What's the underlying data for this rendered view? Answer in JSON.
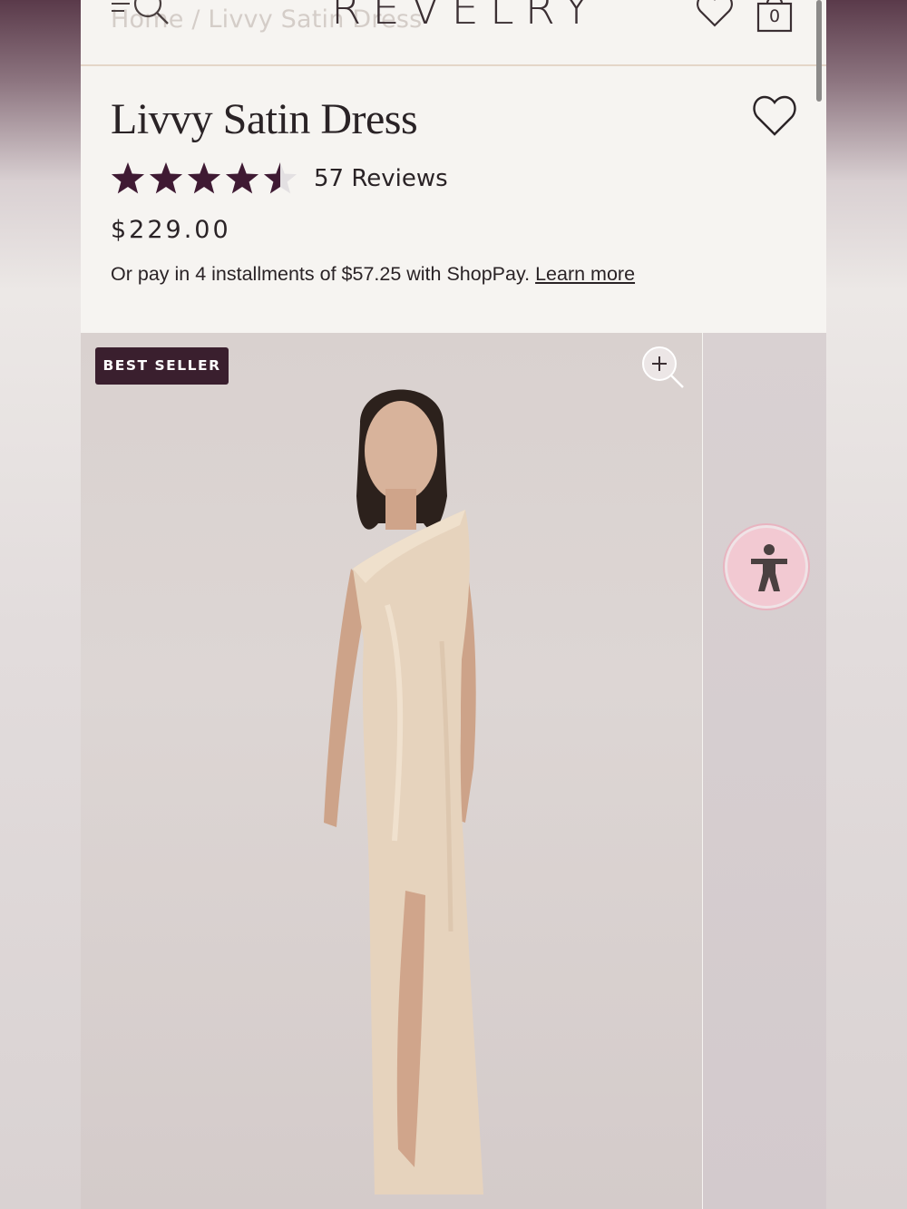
{
  "header": {
    "logo": "REVELRY",
    "breadcrumb": "Home / Livvy Satin Dress",
    "cart_count": "0",
    "icons": [
      "menu-icon",
      "search-icon",
      "heart-icon",
      "shopping-bag-icon"
    ]
  },
  "product": {
    "title": "Livvy Satin Dress",
    "rating": 4.5,
    "rating_max": 5,
    "reviews_label": "57 Reviews",
    "price": "$229.00",
    "installments_text": "Or pay in 4 installments of $57.25 with ShopPay.",
    "learn_more": "Learn more"
  },
  "gallery": {
    "badge": "BEST SELLER",
    "icons": [
      "zoom-in-icon",
      "accessibility-icon"
    ]
  },
  "colors": {
    "brand": "#3a1f2e",
    "star": "#3f1a33",
    "star_empty": "#e3e0e2",
    "page_bg": "#f6f4f1",
    "accessibility_bg": "#f2c9d2"
  }
}
